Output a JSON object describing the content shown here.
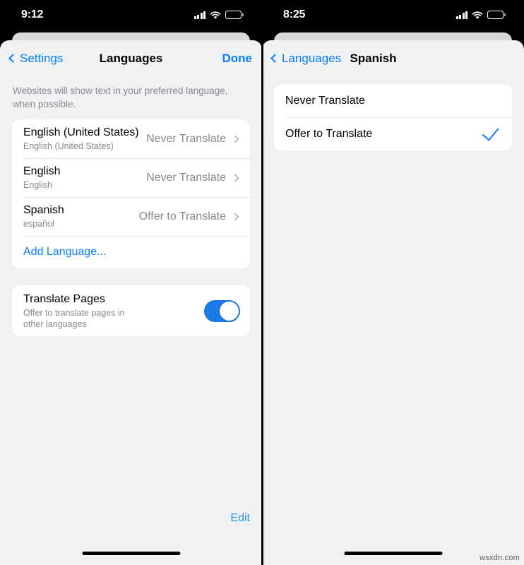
{
  "watermark": "wsxdn.com",
  "left_panel": {
    "status_bar": {
      "time": "9:12",
      "cellular_icon": "cellular-bars-icon",
      "wifi_icon": "wifi-icon",
      "battery_icon": "battery-icon"
    },
    "nav": {
      "back_label": "Settings",
      "title": "Languages",
      "action_label": "Done"
    },
    "footnote": "Websites will show text in your preferred language, when possible.",
    "language_rows": [
      {
        "title": "English (United States)",
        "subtitle": "English (United States)",
        "value": "Never Translate"
      },
      {
        "title": "English",
        "subtitle": "English",
        "value": "Never Translate"
      },
      {
        "title": "Spanish",
        "subtitle": "español",
        "value": "Offer to Translate"
      }
    ],
    "add_language_label": "Add Language...",
    "translate_pages": {
      "title": "Translate Pages",
      "subtitle": "Offer to translate pages in other languages",
      "toggle_state": "on"
    },
    "edit_label": "Edit"
  },
  "right_panel": {
    "status_bar": {
      "time": "8:25",
      "cellular_icon": "cellular-bars-icon",
      "wifi_icon": "wifi-icon",
      "battery_icon": "battery-icon"
    },
    "nav": {
      "back_label": "Languages",
      "title": "Spanish"
    },
    "options": [
      {
        "label": "Never Translate",
        "selected": false
      },
      {
        "label": "Offer to Translate",
        "selected": true
      }
    ]
  },
  "colors": {
    "accent_blue": "#0a7cff",
    "toggle_on": "#1a7ae8",
    "sheet_bg": "#eff1f3",
    "card_bg": "#ffffff",
    "secondary_text": "#8a8a8e",
    "backdrop": "#000000"
  }
}
